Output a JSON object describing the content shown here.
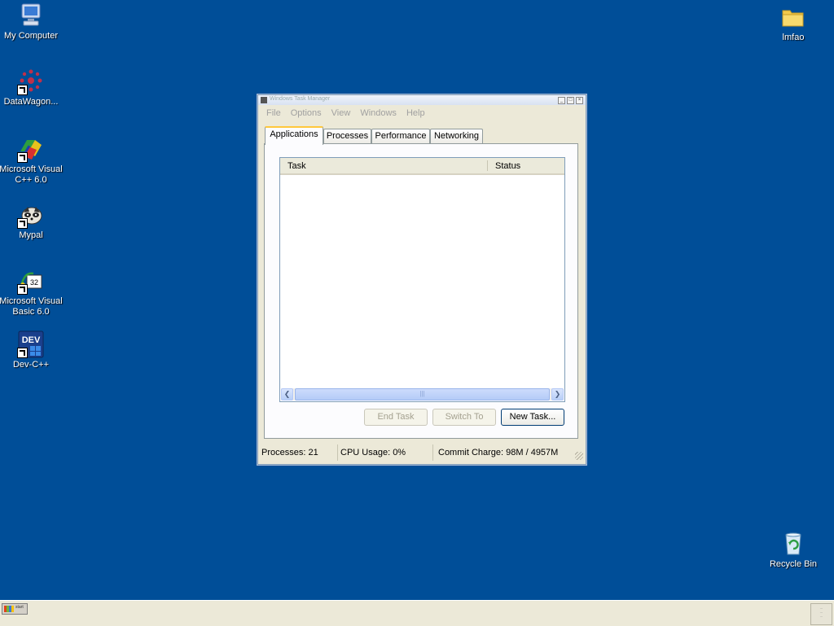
{
  "desktop": {
    "icons": [
      {
        "label": "My Computer"
      },
      {
        "label": "DataWagon..."
      },
      {
        "label": "Microsoft Visual C++ 6.0"
      },
      {
        "label": "Mypal"
      },
      {
        "label": "Microsoft Visual Basic 6.0"
      },
      {
        "label": "Dev-C++"
      },
      {
        "label": "lmfao"
      },
      {
        "label": "Recycle Bin"
      }
    ]
  },
  "window": {
    "title": "Windows Task Manager",
    "menu": [
      "File",
      "Options",
      "View",
      "Windows",
      "Help"
    ],
    "tabs": [
      "Applications",
      "Processes",
      "Performance",
      "Networking"
    ],
    "active_tab": "Applications",
    "list": {
      "columns": [
        "Task",
        "Status"
      ],
      "rows": []
    },
    "buttons": {
      "end_task": "End Task",
      "switch_to": "Switch To",
      "new_task": "New Task..."
    },
    "status": {
      "processes": "Processes: 21",
      "cpu": "CPU Usage: 0%",
      "commit": "Commit Charge: 98M / 4957M"
    }
  },
  "taskbar": {
    "start_label": "start"
  },
  "colors": {
    "desktop": "#004E98",
    "window_face": "#ECE9D8",
    "active_tab_accent": "#FFC83C"
  }
}
